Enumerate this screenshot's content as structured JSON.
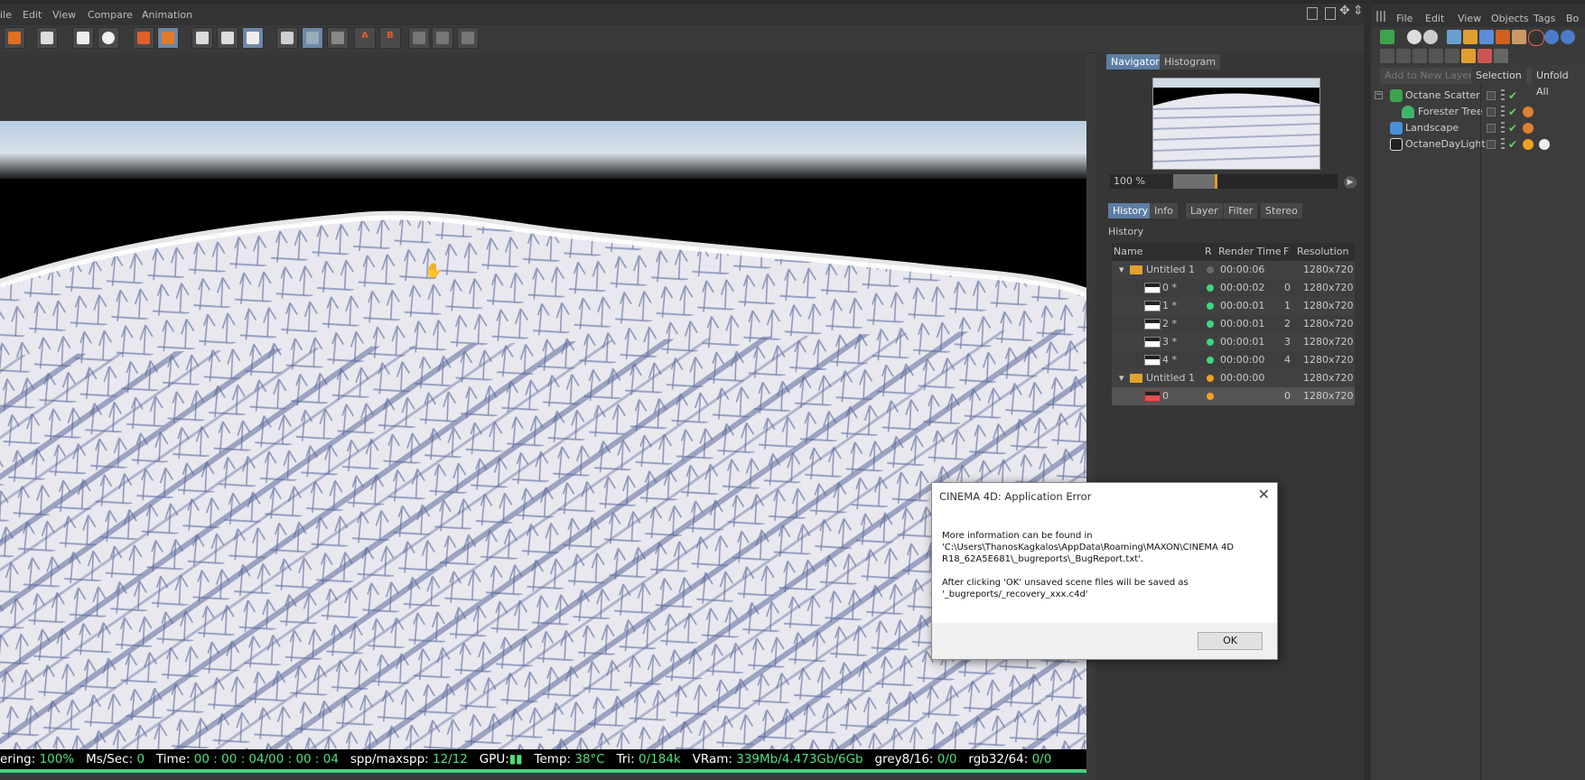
{
  "menubar": {
    "items": [
      "ile",
      "Edit",
      "View",
      "Compare",
      "Animation"
    ]
  },
  "status_bar": {
    "items": [
      {
        "label": "ering:",
        "value": "100%"
      },
      {
        "label": "Ms/Sec:",
        "value": "0"
      },
      {
        "label": "Time:",
        "value": "00 : 00 : 04/00 : 00 : 04"
      },
      {
        "label": "spp/maxspp:",
        "value": "12/12"
      },
      {
        "label": "GPU:",
        "value": "▮▮"
      },
      {
        "label": "Temp:",
        "value": "38°C"
      },
      {
        "label": "Tri:",
        "value": "0/184k"
      },
      {
        "label": "VRam:",
        "value": "339Mb/4.473Gb/6Gb"
      },
      {
        "label": "grey8/16:",
        "value": "0/0"
      },
      {
        "label": "rgb32/64:",
        "value": "0/0"
      }
    ]
  },
  "navigator": {
    "tabs": [
      "Navigator",
      "Histogram"
    ],
    "zoom": "100 %",
    "zoom_fraction": 0.25
  },
  "history_panel": {
    "tabs": [
      "History",
      "Info",
      "Layer",
      "Filter",
      "Stereo"
    ],
    "title": "History",
    "columns": [
      "Name",
      "R",
      "Render Time",
      "F",
      "Resolution"
    ],
    "rows": [
      {
        "name": "Untitled 1",
        "time": "00:00:06",
        "f": "",
        "res": "1280x720",
        "status": "grey"
      },
      {
        "name": "0 *",
        "time": "00:00:02",
        "f": "0",
        "res": "1280x720",
        "status": "green"
      },
      {
        "name": "1 *",
        "time": "00:00:01",
        "f": "1",
        "res": "1280x720",
        "status": "green"
      },
      {
        "name": "2 *",
        "time": "00:00:01",
        "f": "2",
        "res": "1280x720",
        "status": "green"
      },
      {
        "name": "3 *",
        "time": "00:00:01",
        "f": "3",
        "res": "1280x720",
        "status": "green"
      },
      {
        "name": "4 *",
        "time": "00:00:00",
        "f": "4",
        "res": "1280x720",
        "status": "green"
      },
      {
        "name": "Untitled 1",
        "time": "00:00:00",
        "f": "",
        "res": "1280x720",
        "status": "orange"
      },
      {
        "name": "0",
        "time": "",
        "f": "0",
        "res": "1280x720",
        "status": "orange"
      }
    ]
  },
  "object_manager": {
    "menu": [
      "File",
      "Edit",
      "View",
      "Objects",
      "Tags",
      "Bo"
    ],
    "layer_bar": [
      "Add to New Layer",
      "Selection",
      "Unfold All"
    ],
    "objects": [
      {
        "name": "Octane Scatter"
      },
      {
        "name": "Forester Tree"
      },
      {
        "name": "Landscape"
      },
      {
        "name": "OctaneDayLight"
      }
    ]
  },
  "dialog": {
    "title": "CINEMA 4D: Application Error",
    "close": "✕",
    "para1": "More information can be found in\n'C:\\Users\\ThanosKagkalos\\AppData\\Roaming\\MAXON\\CINEMA 4D\nR18_62A5E681\\_bugreports\\_BugReport.txt'.",
    "para2": "After clicking 'OK' unsaved scene files will be saved as\n'_bugreports/_recovery_xxx.c4d'",
    "ok_label": "OK"
  },
  "colors": {
    "status_value": "#4fe07e",
    "selected_tab": "#5d7ea5",
    "status_green": "#3ed67f",
    "status_orange": "#f0a020"
  }
}
